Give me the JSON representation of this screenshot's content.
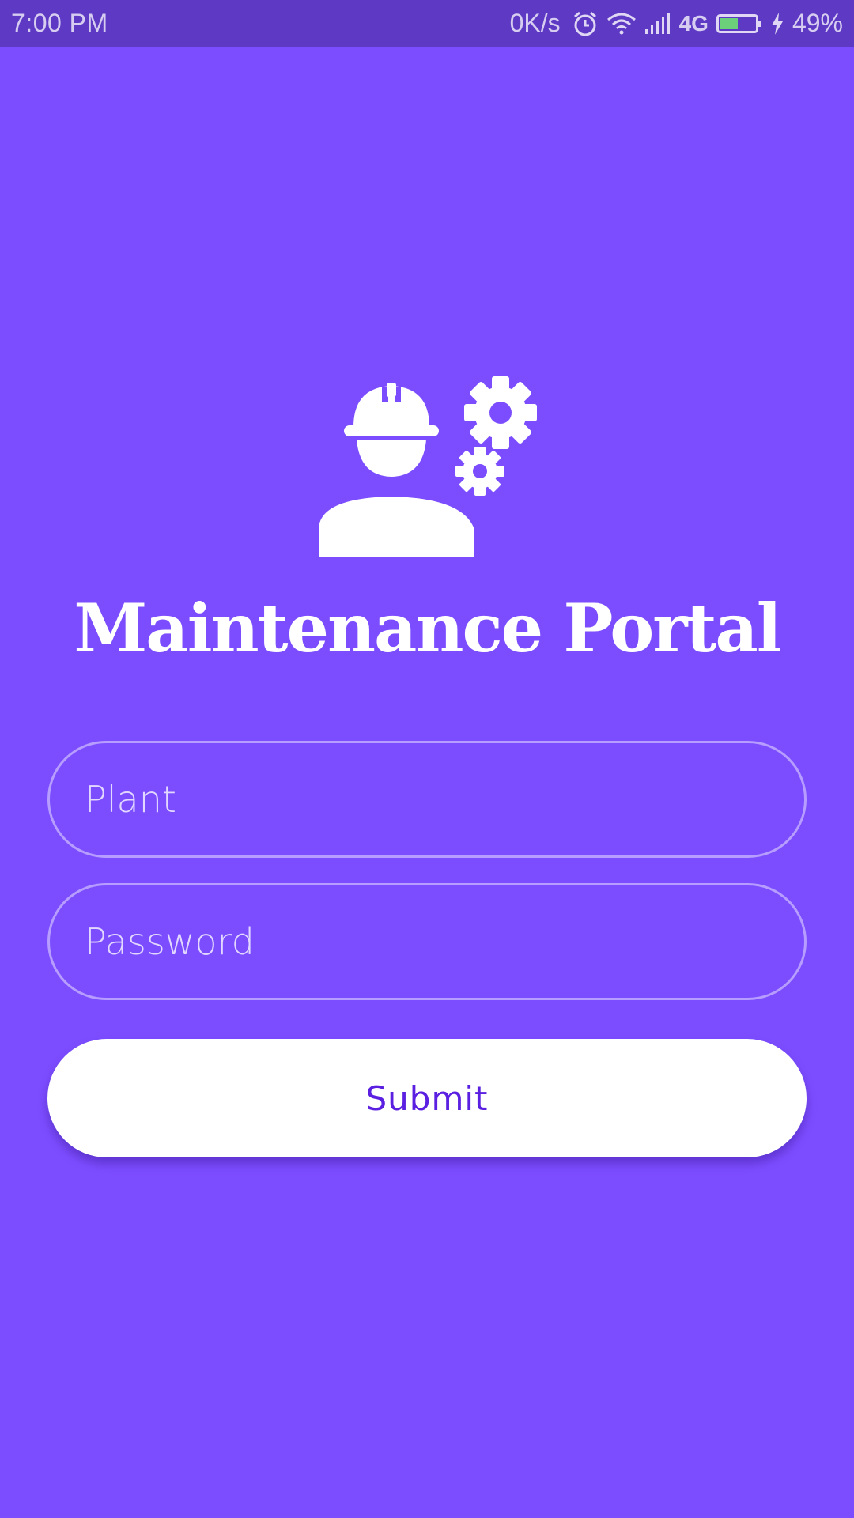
{
  "status_bar": {
    "time": "7:00 PM",
    "net_speed": "0K/s",
    "network_type": "4G",
    "battery_percent": "49%",
    "battery_level": 0.49,
    "icons": [
      "alarm-icon",
      "wifi-icon",
      "signal-icon",
      "battery-icon",
      "charging-icon"
    ]
  },
  "header": {
    "logo_icon": "maintenance-worker-gears-icon",
    "title": "Maintenance Portal"
  },
  "form": {
    "plant_placeholder": "Plant",
    "password_placeholder": "Password",
    "submit_label": "Submit"
  },
  "colors": {
    "background": "#7c4dff",
    "status_bar": "#5e3ac4",
    "button_bg": "#ffffff",
    "button_text": "#5a1fe0",
    "battery_fill": "#6ccf7a"
  }
}
